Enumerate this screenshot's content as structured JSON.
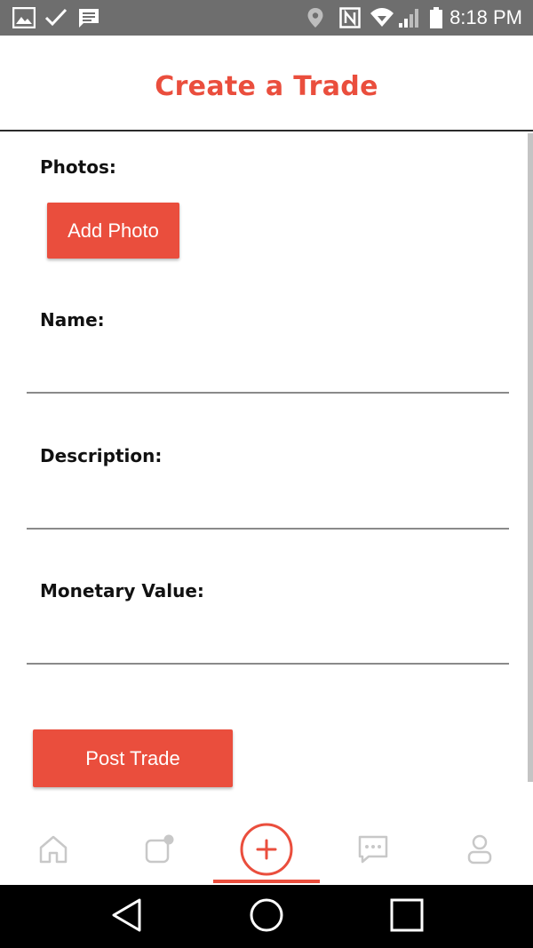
{
  "status_bar": {
    "time": "8:18 PM",
    "left_icons": [
      "image-icon",
      "check-icon",
      "message-icon"
    ],
    "right_icons": [
      "location-icon",
      "nfc-icon",
      "wifi-icon",
      "signal-icon",
      "battery-icon"
    ]
  },
  "header": {
    "title": "Create a Trade"
  },
  "form": {
    "photos_label": "Photos:",
    "add_photo_label": "Add Photo",
    "name_label": "Name:",
    "name_value": "",
    "description_label": "Description:",
    "description_value": "",
    "monetary_value_label": "Monetary Value:",
    "monetary_value_value": "",
    "post_trade_label": "Post Trade"
  },
  "bottom_nav": {
    "items": [
      {
        "icon": "home-icon",
        "active": false
      },
      {
        "icon": "trades-icon",
        "active": false
      },
      {
        "icon": "create-trade-icon",
        "active": true
      },
      {
        "icon": "chat-icon",
        "active": false
      },
      {
        "icon": "profile-icon",
        "active": false
      }
    ]
  },
  "system_nav": {
    "icons": [
      "back-icon",
      "home-circle-icon",
      "recents-icon"
    ]
  },
  "colors": {
    "accent": "#ea4e3d",
    "status_bar": "#6e6e6e",
    "nav_inactive": "#c8c8c8",
    "text": "#111111"
  }
}
